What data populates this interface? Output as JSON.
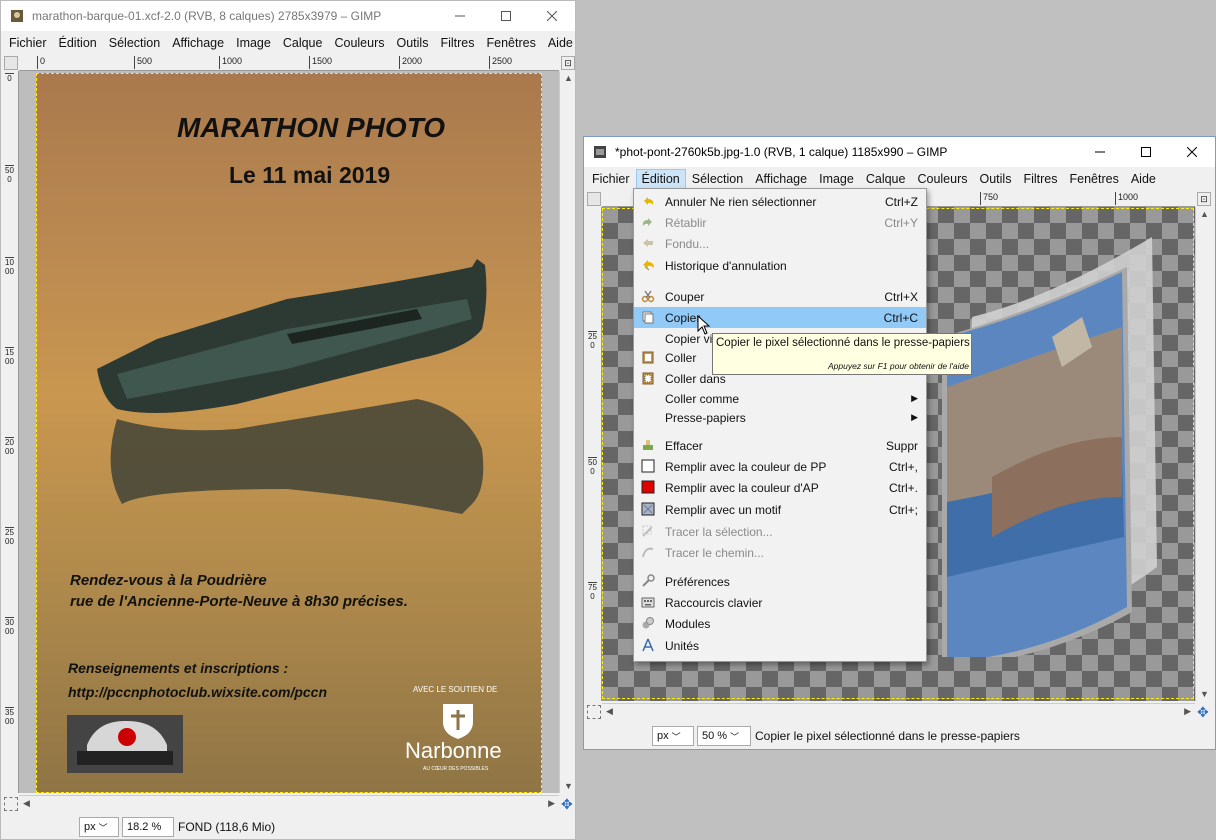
{
  "left_window": {
    "title": "marathon-barque-01.xcf-2.0 (RVB, 8 calques) 2785x3979 – GIMP",
    "menu": [
      "Fichier",
      "Édition",
      "Sélection",
      "Affichage",
      "Image",
      "Calque",
      "Couleurs",
      "Outils",
      "Filtres",
      "Fenêtres",
      "Aide"
    ],
    "ruler_h": [
      "0",
      "500",
      "1000",
      "1500",
      "2000",
      "2500"
    ],
    "ruler_v": [
      "0",
      "500",
      "1000",
      "1500",
      "2000",
      "2500",
      "3000",
      "3500"
    ],
    "poster": {
      "title": "MARATHON PHOTO",
      "date": "Le 11 mai 2019",
      "venue_line1": "Rendez-vous à la Poudrière",
      "venue_line2": "rue de l'Ancienne-Porte-Neuve à 8h30 précises.",
      "info_line1": "Renseignements et inscriptions :",
      "info_line2": "http://pccnphotoclub.wixsite.com/pccn",
      "support": "AVEC LE SOUTIEN DE",
      "city": "Narbonne",
      "city_tagline": "AU CŒUR DES POSSIBLES"
    },
    "status": {
      "unit": "px",
      "zoom": "18.2 %",
      "info": "FOND (118,6 Mio)"
    }
  },
  "right_window": {
    "title": "*phot-pont-2760k5b.jpg-1.0 (RVB, 1 calque) 1185x990 – GIMP",
    "menu": [
      "Fichier",
      "Édition",
      "Sélection",
      "Affichage",
      "Image",
      "Calque",
      "Couleurs",
      "Outils",
      "Filtres",
      "Fenêtres",
      "Aide"
    ],
    "ruler_h": [
      "750",
      "1000"
    ],
    "ruler_v": [
      "250",
      "500",
      "750"
    ],
    "status": {
      "unit": "px",
      "zoom": "50 %",
      "info": "Copier le pixel sélectionné dans le presse-papiers"
    }
  },
  "edit_menu": {
    "items": [
      {
        "label": "Annuler Ne rien sélectionner",
        "shortcut": "Ctrl+Z",
        "icon": "undo-icon",
        "disabled": false
      },
      {
        "label": "Rétablir",
        "shortcut": "Ctrl+Y",
        "icon": "redo-icon",
        "disabled": true
      },
      {
        "label": "Fondu...",
        "shortcut": "",
        "icon": "fade-icon",
        "disabled": true
      },
      {
        "label": "Historique d'annulation",
        "shortcut": "",
        "icon": "undo-history-icon",
        "disabled": false
      },
      {
        "label": "Couper",
        "shortcut": "Ctrl+X",
        "icon": "scissors-icon",
        "disabled": false
      },
      {
        "label": "Copier",
        "shortcut": "Ctrl+C",
        "icon": "copy-icon",
        "disabled": false,
        "highlighted": true
      },
      {
        "label": "Copier vi",
        "shortcut": "",
        "icon": "",
        "disabled": false
      },
      {
        "label": "Coller",
        "shortcut": "",
        "icon": "paste-icon",
        "disabled": false
      },
      {
        "label": "Coller dans",
        "shortcut": "",
        "icon": "paste-into-icon",
        "disabled": false
      },
      {
        "label": "Coller comme",
        "shortcut": "",
        "icon": "",
        "disabled": false,
        "submenu": true
      },
      {
        "label": "Presse-papiers",
        "shortcut": "",
        "icon": "",
        "disabled": false,
        "submenu": true
      },
      {
        "label": "Effacer",
        "shortcut": "Suppr",
        "icon": "clear-icon",
        "disabled": false
      },
      {
        "label": "Remplir avec la couleur de PP",
        "shortcut": "Ctrl+,",
        "icon": "fg-fill-icon",
        "disabled": false
      },
      {
        "label": "Remplir avec la couleur d'AP",
        "shortcut": "Ctrl+.",
        "icon": "bg-fill-icon",
        "disabled": false
      },
      {
        "label": "Remplir avec un motif",
        "shortcut": "Ctrl+;",
        "icon": "pattern-fill-icon",
        "disabled": false
      },
      {
        "label": "Tracer la sélection...",
        "shortcut": "",
        "icon": "stroke-selection-icon",
        "disabled": true
      },
      {
        "label": "Tracer le chemin...",
        "shortcut": "",
        "icon": "stroke-path-icon",
        "disabled": true
      },
      {
        "label": "Préférences",
        "shortcut": "",
        "icon": "preferences-icon",
        "disabled": false
      },
      {
        "label": "Raccourcis clavier",
        "shortcut": "",
        "icon": "keyboard-icon",
        "disabled": false
      },
      {
        "label": "Modules",
        "shortcut": "",
        "icon": "modules-icon",
        "disabled": false
      },
      {
        "label": "Unités",
        "shortcut": "",
        "icon": "units-icon",
        "disabled": false
      }
    ]
  },
  "tooltip": {
    "text": "Copier le pixel sélectionné dans le presse-papiers",
    "hint": "Appuyez sur F1 pour obtenir de l'aide"
  },
  "colors": {
    "accent_highlight": "#91c9f7",
    "menu_open": "#cce4f7",
    "tooltip_bg": "#ffffe1",
    "bg_fill": "#e00000"
  }
}
